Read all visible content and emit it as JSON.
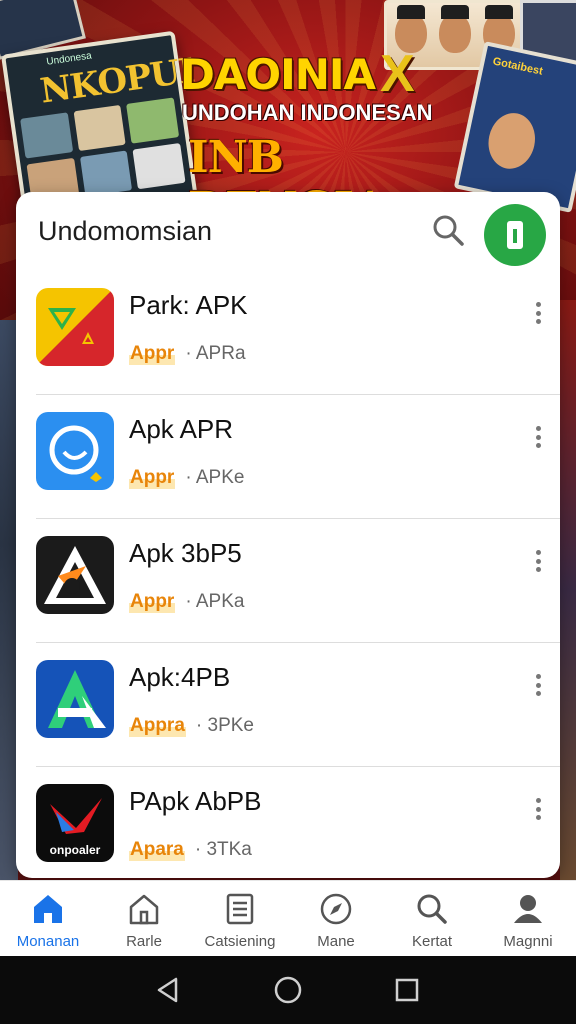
{
  "banner": {
    "headline_line1": "DAOINIA",
    "headline_mark": "X",
    "headline_line2": "UNDOHAN INDONESAN",
    "headline_line3": "INB DENGIA",
    "left_card_top": "Undonesa",
    "left_card_title": "NKOPUI",
    "right_card_title": "Gotaibest"
  },
  "panel": {
    "title": "Undomomsian",
    "search_icon": "search-icon",
    "avatar_icon": "app-logo-icon",
    "accent_color": "#28a745"
  },
  "apps": [
    {
      "name": "Park: APK",
      "badge": "Appr",
      "meta": "· APRa",
      "icon": "colorful-triangle-icon"
    },
    {
      "name": "Apk APR",
      "badge": "Appr",
      "meta": "· APKe",
      "icon": "blue-circle-icon"
    },
    {
      "name": "Apk 3bP5",
      "badge": "Appr",
      "meta": "· APKa",
      "icon": "black-triangle-icon"
    },
    {
      "name": "Apk:4PB",
      "badge": "Appra",
      "meta": "· 3PKe",
      "icon": "blue-a-icon"
    },
    {
      "name": "PApk AbPB",
      "badge": "Apara",
      "meta": "· 3TKa",
      "icon": "onpoaler-icon"
    }
  ],
  "app_icon_texts": {
    "onpoaler": "onpoaler"
  },
  "bottom_nav": [
    {
      "label": "Monanan",
      "icon": "home-icon",
      "active": true
    },
    {
      "label": "Rarle",
      "icon": "house-outline-icon",
      "active": false
    },
    {
      "label": "Catsiening",
      "icon": "document-icon",
      "active": false
    },
    {
      "label": "Mane",
      "icon": "compass-icon",
      "active": false
    },
    {
      "label": "Kertat",
      "icon": "search-icon",
      "active": false
    },
    {
      "label": "Magnni",
      "icon": "person-icon",
      "active": false
    }
  ],
  "system_bar": {
    "back_icon": "back-triangle-icon",
    "home_icon": "home-circle-icon",
    "recents_icon": "recents-square-icon"
  },
  "colors": {
    "badge": "#e8850a",
    "nav_active": "#1a73e8",
    "banner_red": "#8e1414",
    "headline_yellow": "#ffd400"
  }
}
